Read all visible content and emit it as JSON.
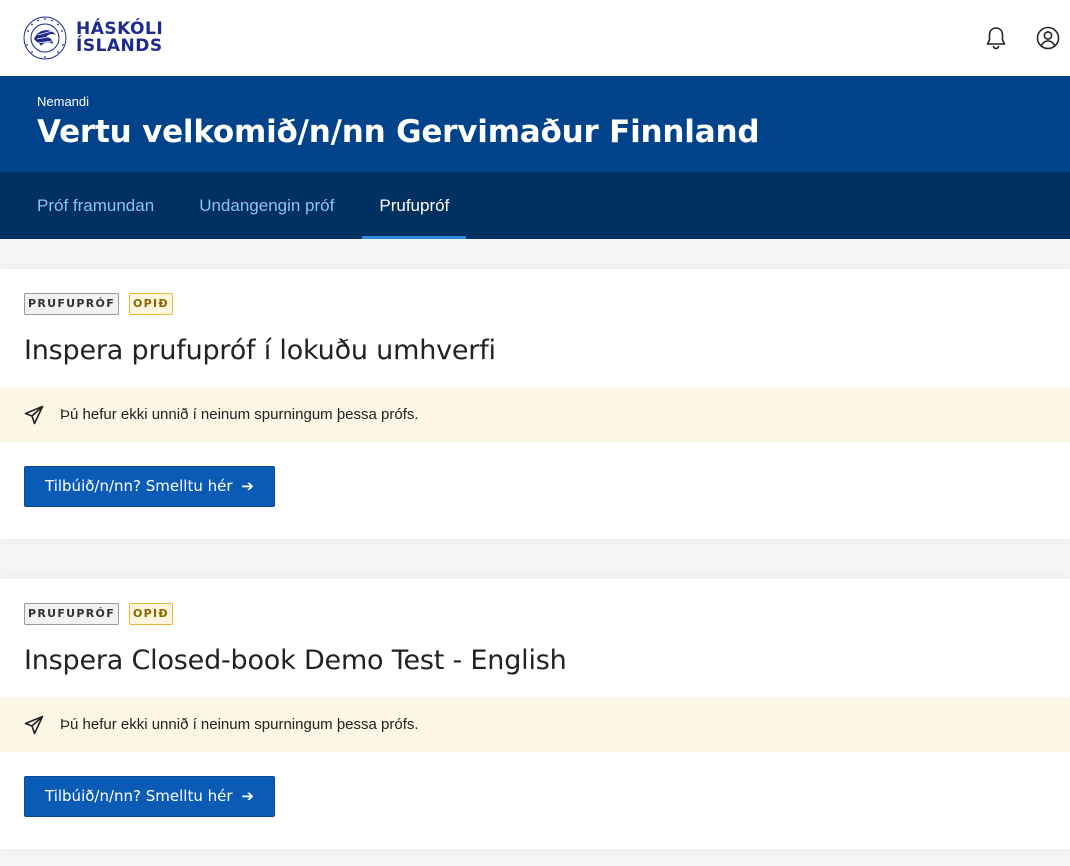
{
  "brand": {
    "line1": "HÁSKÓLI",
    "line2": "ÍSLANDS"
  },
  "icons": {
    "notifications": "bell-icon",
    "account": "user-circle-icon",
    "notice": "paper-plane-icon"
  },
  "header": {
    "role": "Nemandi",
    "title": "Vertu velkomið/n/nn Gervimaður Finnland"
  },
  "tabs": [
    {
      "label": "Próf framundan",
      "active": false
    },
    {
      "label": "Undangengin próf",
      "active": false
    },
    {
      "label": "Prufupróf",
      "active": true
    }
  ],
  "exams": [
    {
      "tags": [
        "PRUFUPRÓF",
        "OPIÐ"
      ],
      "title": "Inspera prufupróf í lokuðu umhverfi",
      "notice": "Þú hefur ekki unnið í neinum spurningum þessa prófs.",
      "button": "Tilbúið/n/nn? Smelltu hér",
      "button_arrow": "➔"
    },
    {
      "tags": [
        "PRUFUPRÓF",
        "OPIÐ"
      ],
      "title": "Inspera Closed-book Demo Test - English",
      "notice": "Þú hefur ekki unnið í neinum spurningum þessa prófs.",
      "button": "Tilbúið/n/nn? Smelltu hér",
      "button_arrow": "➔"
    }
  ],
  "colors": {
    "brand_navy": "#1d2a8e",
    "hero": "#00438a",
    "tabs": "#00305f",
    "tab_indicator": "#2c8ae6",
    "button": "#0a5bb5",
    "notice_bg": "#fcf6e4"
  }
}
